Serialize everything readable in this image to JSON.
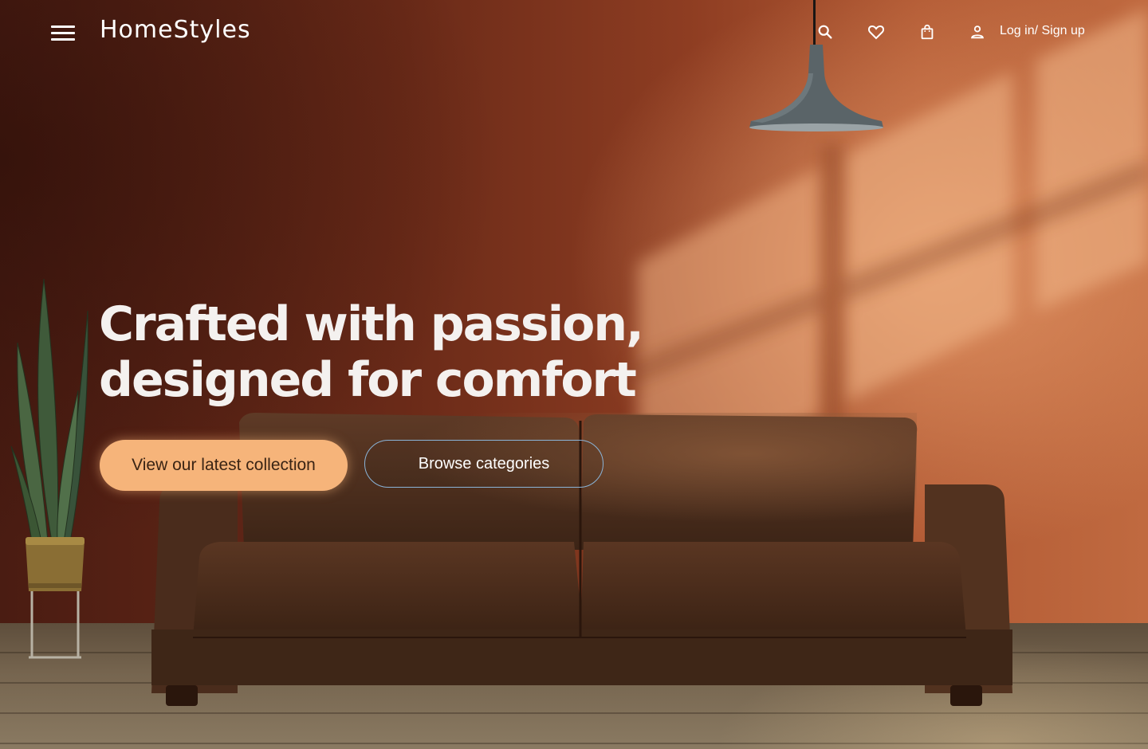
{
  "brand": {
    "name": "HomeStyles"
  },
  "header": {
    "menu_icon": "hamburger-menu-icon",
    "icons": [
      "search-icon",
      "heart-icon",
      "shopping-bag-icon",
      "user-icon"
    ],
    "login_label": "Log in/ Sign up"
  },
  "hero": {
    "headline_line1": "Crafted with passion,",
    "headline_line2": "designed for comfort",
    "primary_button": "View our latest collection",
    "secondary_button": "Browse categories"
  },
  "colors": {
    "primary_button_bg": "#f6b47a",
    "secondary_button_border": "#8ab4d8",
    "wall": "#8e3d22",
    "text": "#f4f1ef"
  }
}
